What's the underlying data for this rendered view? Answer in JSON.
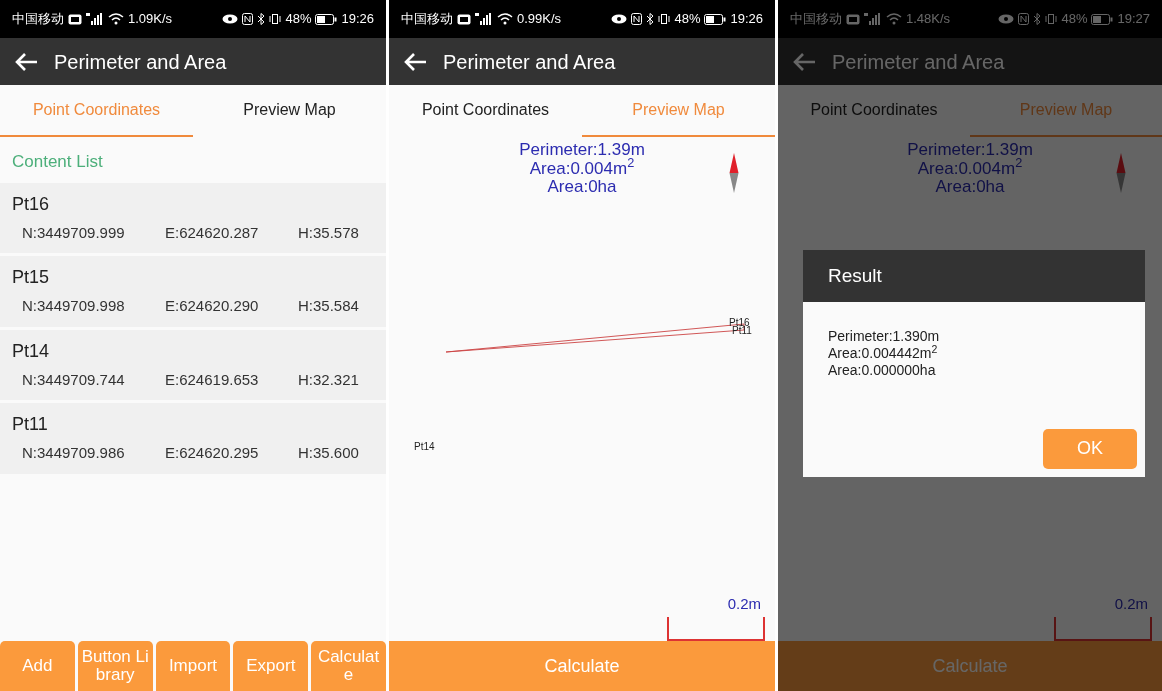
{
  "screens": [
    {
      "kind": "list",
      "status_bar": {
        "carrier": "中国移动",
        "speed": "1.09K/s",
        "battery": "48%",
        "time": "19:26"
      },
      "title": "Perimeter and Area",
      "tabs": [
        {
          "label": "Point Coordinates",
          "selected": true
        },
        {
          "label": "Preview Map",
          "selected": false
        }
      ],
      "section_title": "Content List",
      "points": [
        {
          "name": "Pt16",
          "n": "N:3449709.999",
          "e": "E:624620.287",
          "h": "H:35.578"
        },
        {
          "name": "Pt15",
          "n": "N:3449709.998",
          "e": "E:624620.290",
          "h": "H:35.584"
        },
        {
          "name": "Pt14",
          "n": "N:3449709.744",
          "e": "E:624619.653",
          "h": "H:32.321"
        },
        {
          "name": "Pt11",
          "n": "N:3449709.986",
          "e": "E:624620.295",
          "h": "H:35.600"
        }
      ],
      "buttons": [
        "Add",
        "Button Library",
        "Import",
        "Export",
        "Calculate"
      ]
    },
    {
      "kind": "map",
      "status_bar": {
        "carrier": "中国移动",
        "speed": "0.99K/s",
        "battery": "48%",
        "time": "19:26"
      },
      "title": "Perimeter and Area",
      "tabs": [
        {
          "label": "Point Coordinates",
          "selected": false
        },
        {
          "label": "Preview Map",
          "selected": true
        }
      ],
      "summary": [
        "Perimeter:1.39m",
        "Area:0.004m$^{2}$",
        "Area:0ha"
      ],
      "map_labels": [
        "Pt16",
        "Pt11",
        "Pt14"
      ],
      "scale": "0.2m",
      "buttons": [
        "Calculate"
      ]
    },
    {
      "kind": "map",
      "status_bar": {
        "carrier": "中国移动",
        "speed": "1.48K/s",
        "battery": "48%",
        "time": "19:27"
      },
      "title": "Perimeter and Area",
      "tabs": [
        {
          "label": "Point Coordinates",
          "selected": false
        },
        {
          "label": "Preview Map",
          "selected": true
        }
      ],
      "summary": [
        "Perimeter:1.39m",
        "Area:0.004m$^{2}$",
        "Area:0ha"
      ],
      "scale": "0.2m",
      "buttons": [
        "Calculate"
      ],
      "dialog": {
        "title": "Result",
        "lines": [
          "Perimeter:1.390m",
          "Area:0.004442m$^{2}$",
          "Area:0.000000ha"
        ],
        "button": "OK"
      }
    }
  ]
}
